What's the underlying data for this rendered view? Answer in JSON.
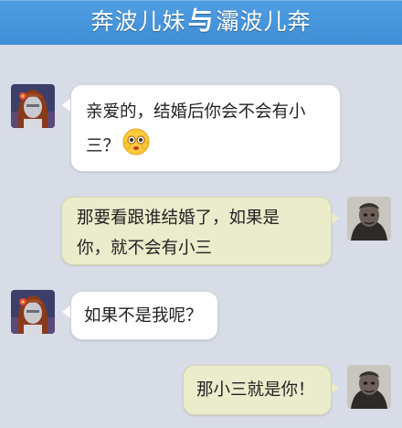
{
  "header": {
    "title_part1": "奔波儿妹",
    "title_join": "与",
    "title_part2": "灞波儿奔"
  },
  "messages": [
    {
      "side": "left",
      "sender": "female-avatar",
      "lines": [
        "亲爱的，结婚后你会不会有小",
        "三？"
      ],
      "emoji": "worried-face-emoji"
    },
    {
      "side": "right",
      "sender": "male-avatar",
      "lines": [
        "那要看跟谁结婚了，如果是",
        "你，就不会有小三"
      ]
    },
    {
      "side": "left",
      "sender": "female-avatar",
      "lines": [
        "如果不是我呢？"
      ]
    },
    {
      "side": "right",
      "sender": "male-avatar",
      "lines": [
        "那小三就是你！"
      ]
    }
  ],
  "colors": {
    "header": "#4a99e0",
    "background": "#d8dce6",
    "bubble_left": "#ffffff",
    "bubble_right": "#ebeccc"
  }
}
